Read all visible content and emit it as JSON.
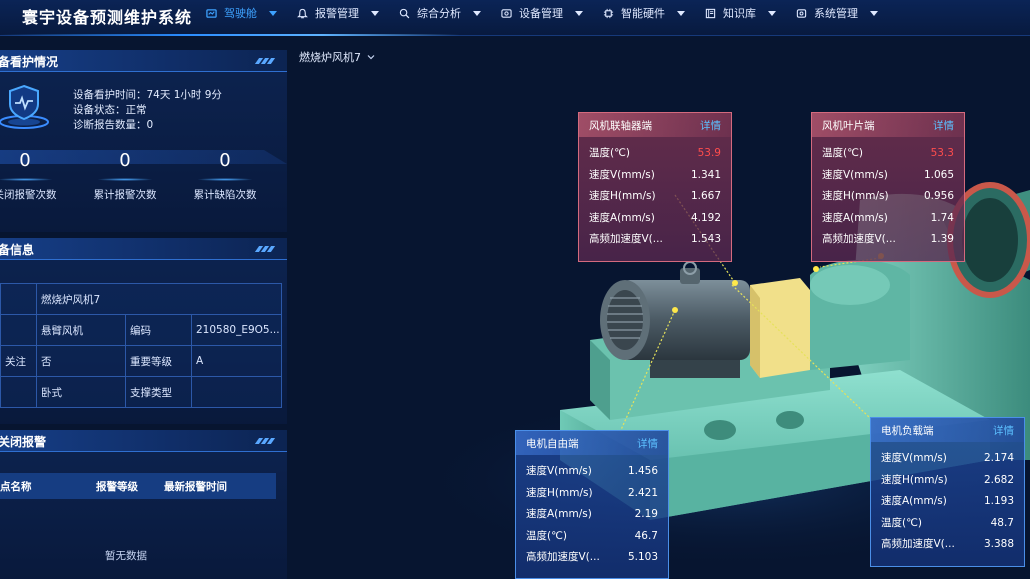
{
  "app": {
    "title": "寰宇设备预测维护系统"
  },
  "nav": [
    {
      "label": "驾驶舱",
      "icon": "dashboard-icon",
      "active": true
    },
    {
      "label": "报警管理",
      "icon": "alarm-icon",
      "active": false
    },
    {
      "label": "综合分析",
      "icon": "analysis-icon",
      "active": false
    },
    {
      "label": "设备管理",
      "icon": "device-icon",
      "active": false
    },
    {
      "label": "智能硬件",
      "icon": "chip-icon",
      "active": false
    },
    {
      "label": "知识库",
      "icon": "book-icon",
      "active": false
    },
    {
      "label": "系统管理",
      "icon": "settings-icon",
      "active": false
    }
  ],
  "care": {
    "title": "备看护情况",
    "lines": [
      "设备看护时间：74天 1小时 9分",
      "设备状态：正常",
      "诊断报告数量：0"
    ],
    "stats": [
      {
        "value": "0",
        "label": "关闭报警次数"
      },
      {
        "value": "0",
        "label": "累计报警次数"
      },
      {
        "value": "0",
        "label": "累计缺陷次数"
      }
    ]
  },
  "info": {
    "title": "备信息",
    "rows": [
      [
        "",
        "燃烧炉风机7",
        "",
        ""
      ],
      [
        "",
        "悬臂风机",
        "编码",
        "210580_E9O5..."
      ],
      [
        "关注",
        "否",
        "重要等级",
        "A"
      ],
      [
        "",
        "卧式",
        "支撑类型",
        ""
      ]
    ]
  },
  "alarm": {
    "title": "关闭报警",
    "columns": [
      "点名称",
      "报警等级",
      "最新报警时间"
    ],
    "empty": "暂无数据"
  },
  "device": {
    "selected": "燃烧炉风机7"
  },
  "cards": [
    {
      "id": "coupling",
      "title": "风机联轴器端",
      "detail": "详情",
      "tone": "red",
      "rows": [
        {
          "k": "温度(℃)",
          "v": "53.9",
          "hot": true
        },
        {
          "k": "速度V(mm/s)",
          "v": "1.341"
        },
        {
          "k": "速度H(mm/s)",
          "v": "1.667"
        },
        {
          "k": "速度A(mm/s)",
          "v": "4.192"
        },
        {
          "k": "高频加速度V(...",
          "v": "1.543"
        }
      ]
    },
    {
      "id": "impeller",
      "title": "风机叶片端",
      "detail": "详情",
      "tone": "red",
      "rows": [
        {
          "k": "温度(℃)",
          "v": "53.3",
          "hot": true
        },
        {
          "k": "速度V(mm/s)",
          "v": "1.065"
        },
        {
          "k": "速度H(mm/s)",
          "v": "0.956"
        },
        {
          "k": "速度A(mm/s)",
          "v": "1.74"
        },
        {
          "k": "高频加速度V(...",
          "v": "1.39"
        }
      ]
    },
    {
      "id": "motor-free",
      "title": "电机自由端",
      "detail": "详情",
      "tone": "blue",
      "rows": [
        {
          "k": "速度V(mm/s)",
          "v": "1.456"
        },
        {
          "k": "速度H(mm/s)",
          "v": "2.421"
        },
        {
          "k": "速度A(mm/s)",
          "v": "2.19"
        },
        {
          "k": "温度(℃)",
          "v": "46.7"
        },
        {
          "k": "高频加速度V(...",
          "v": "5.103"
        }
      ]
    },
    {
      "id": "motor-load",
      "title": "电机负载端",
      "detail": "详情",
      "tone": "blue",
      "rows": [
        {
          "k": "速度V(mm/s)",
          "v": "2.174"
        },
        {
          "k": "速度H(mm/s)",
          "v": "2.682"
        },
        {
          "k": "速度A(mm/s)",
          "v": "1.193"
        },
        {
          "k": "温度(℃)",
          "v": "48.7"
        },
        {
          "k": "高频加速度V(...",
          "v": "3.388"
        }
      ]
    }
  ],
  "colors": {
    "accent": "#3ea2ff",
    "hot": "#ff4d4d",
    "bg": "#071530"
  }
}
